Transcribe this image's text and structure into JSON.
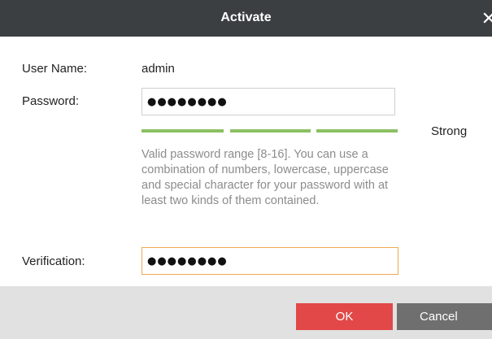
{
  "dialog": {
    "title": "Activate",
    "close_icon": "close-icon"
  },
  "form": {
    "username_label": "User Name:",
    "username_value": "admin",
    "password_label": "Password:",
    "password_value": "●●●●●●●●",
    "strength_label": "Strong",
    "strength_color": "#8cc063",
    "hint": "Valid password range [8-16]. You can use a combination of numbers, lowercase, uppercase and special character for your password with at least two kinds of them contained.",
    "verification_label": "Verification:",
    "verification_value": "●●●●●●●●"
  },
  "buttons": {
    "ok_label": "OK",
    "cancel_label": "Cancel"
  },
  "colors": {
    "titlebar": "#3b3f42",
    "ok_button": "#e24848",
    "cancel_button": "#6f6f6f",
    "focus_border": "#f0a851",
    "footer": "#e1e1e1"
  }
}
